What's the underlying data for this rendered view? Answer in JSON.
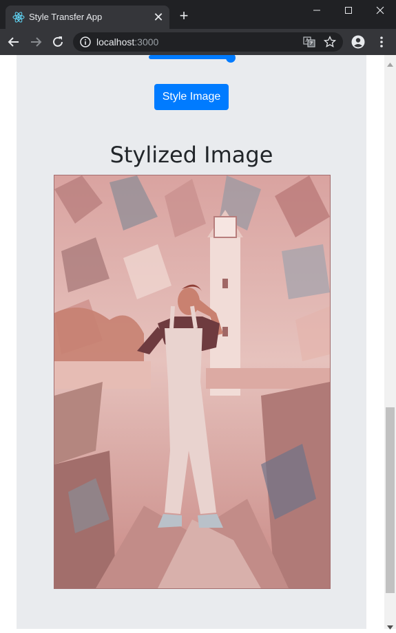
{
  "browser": {
    "tab_title": "Style Transfer App",
    "new_tab_symbol": "+",
    "close_tab_symbol": "✕",
    "url_host": "localhost",
    "url_port": ":3000",
    "icons": {
      "favicon": "react-atom-icon",
      "back": "arrow-left-icon",
      "forward": "arrow-right-icon",
      "reload": "reload-icon",
      "site_info": "info-icon",
      "translate": "translate-icon",
      "bookmark": "star-icon",
      "profile": "account-circle-icon",
      "menu": "more-vertical-icon",
      "minimize": "minimize-icon",
      "maximize": "maximize-icon",
      "close": "close-icon"
    }
  },
  "page": {
    "slider_level": 1.0,
    "style_button_label": "Style Image",
    "stylized_heading": "Stylized Image",
    "accent_color": "#007bff",
    "panel_color": "#e9ebee"
  }
}
